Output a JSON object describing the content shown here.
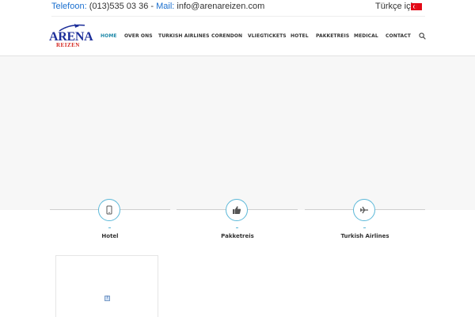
{
  "topbar": {
    "phone_label": "Telefoon:",
    "phone": "(013)535 03 36",
    "separator": " - ",
    "mail_label": "Mail:",
    "email": "info@arenareizen.com",
    "language_label": "Türkçe için:",
    "flag_icon": "turkey-flag"
  },
  "logo": {
    "name": "ARENA",
    "subtitle": "REIZEN"
  },
  "nav": {
    "items": [
      {
        "label": "HOME",
        "active": true
      },
      {
        "label": "OVER ONS"
      },
      {
        "label": "TURKISH AIRLINES"
      },
      {
        "label": "CORENDON"
      },
      {
        "label": "VLIEGTICKETS"
      },
      {
        "label": "HOTEL"
      },
      {
        "label": "PAKKETREIS"
      },
      {
        "label": "MEDICAL"
      },
      {
        "label": "CONTACT"
      }
    ],
    "search_icon": "search-icon"
  },
  "features": [
    {
      "title": "Hotel",
      "icon": "mobile-phone-icon"
    },
    {
      "title": "Pakketreis",
      "icon": "thumbs-up-icon"
    },
    {
      "title": "Turkish Airlines",
      "icon": "airplane-icon"
    }
  ],
  "colors": {
    "accent": "#1e88a8",
    "icon_ring": "#5bb8d8",
    "link_blue": "#1a6fcf",
    "logo_blue": "#1d2f9a",
    "logo_red": "#d4261f",
    "flag_red": "#e30a17"
  }
}
